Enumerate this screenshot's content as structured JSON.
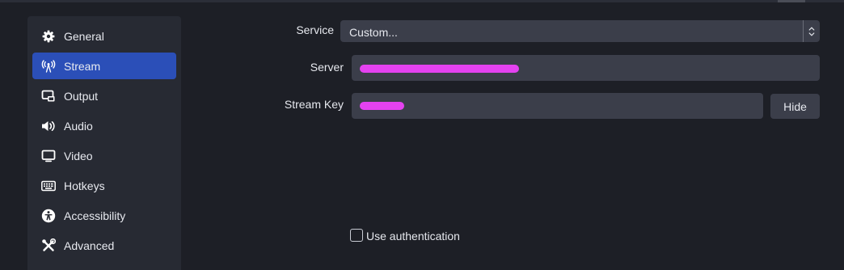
{
  "sidebar": {
    "items": [
      {
        "label": "General",
        "icon": "gear-icon",
        "active": false
      },
      {
        "label": "Stream",
        "icon": "broadcast-antenna-icon",
        "active": true
      },
      {
        "label": "Output",
        "icon": "output-monitor-icon",
        "active": false
      },
      {
        "label": "Audio",
        "icon": "speaker-icon",
        "active": false
      },
      {
        "label": "Video",
        "icon": "monitor-icon",
        "active": false
      },
      {
        "label": "Hotkeys",
        "icon": "keyboard-icon",
        "active": false
      },
      {
        "label": "Accessibility",
        "icon": "accessibility-icon",
        "active": false
      },
      {
        "label": "Advanced",
        "icon": "tools-icon",
        "active": false
      }
    ]
  },
  "stream": {
    "service_label": "Service",
    "service_value": "Custom...",
    "server_label": "Server",
    "stream_key_label": "Stream Key",
    "hide_button_label": "Hide",
    "use_auth_label": "Use authentication",
    "use_auth_checked": false
  },
  "colors": {
    "background": "#1d1f26",
    "sidebar": "#272a33",
    "active_item": "#2b4fb8",
    "field": "#3b3e4a",
    "redaction": "#e442f0"
  }
}
